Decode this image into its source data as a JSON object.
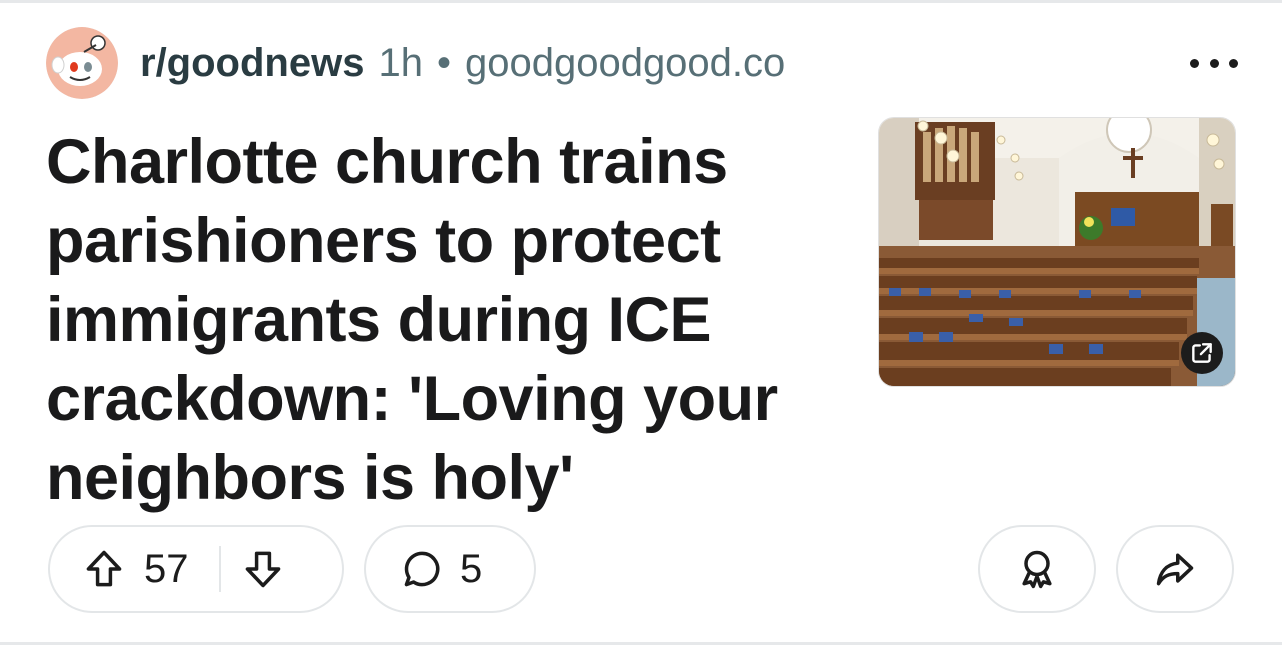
{
  "post": {
    "subreddit": "r/goodnews",
    "age": "1h",
    "separator": "•",
    "domain": "goodgoodgood.co",
    "title": "Charlotte church trains parishioners to protect immigrants during ICE crackdown: 'Loving your neighbors is holy'",
    "upvotes": "57",
    "comments": "5"
  },
  "icons": {
    "avatar": "snoo-avatar-icon",
    "more": "more-options-icon",
    "external": "external-link-icon",
    "upvote": "upvote-arrow-icon",
    "downvote": "downvote-arrow-icon",
    "comment": "comment-bubble-icon",
    "award": "award-icon",
    "share": "share-arrow-icon"
  },
  "colors": {
    "text": "#1a1a1b",
    "meta": "#576f76",
    "border": "#e3e6e8"
  }
}
